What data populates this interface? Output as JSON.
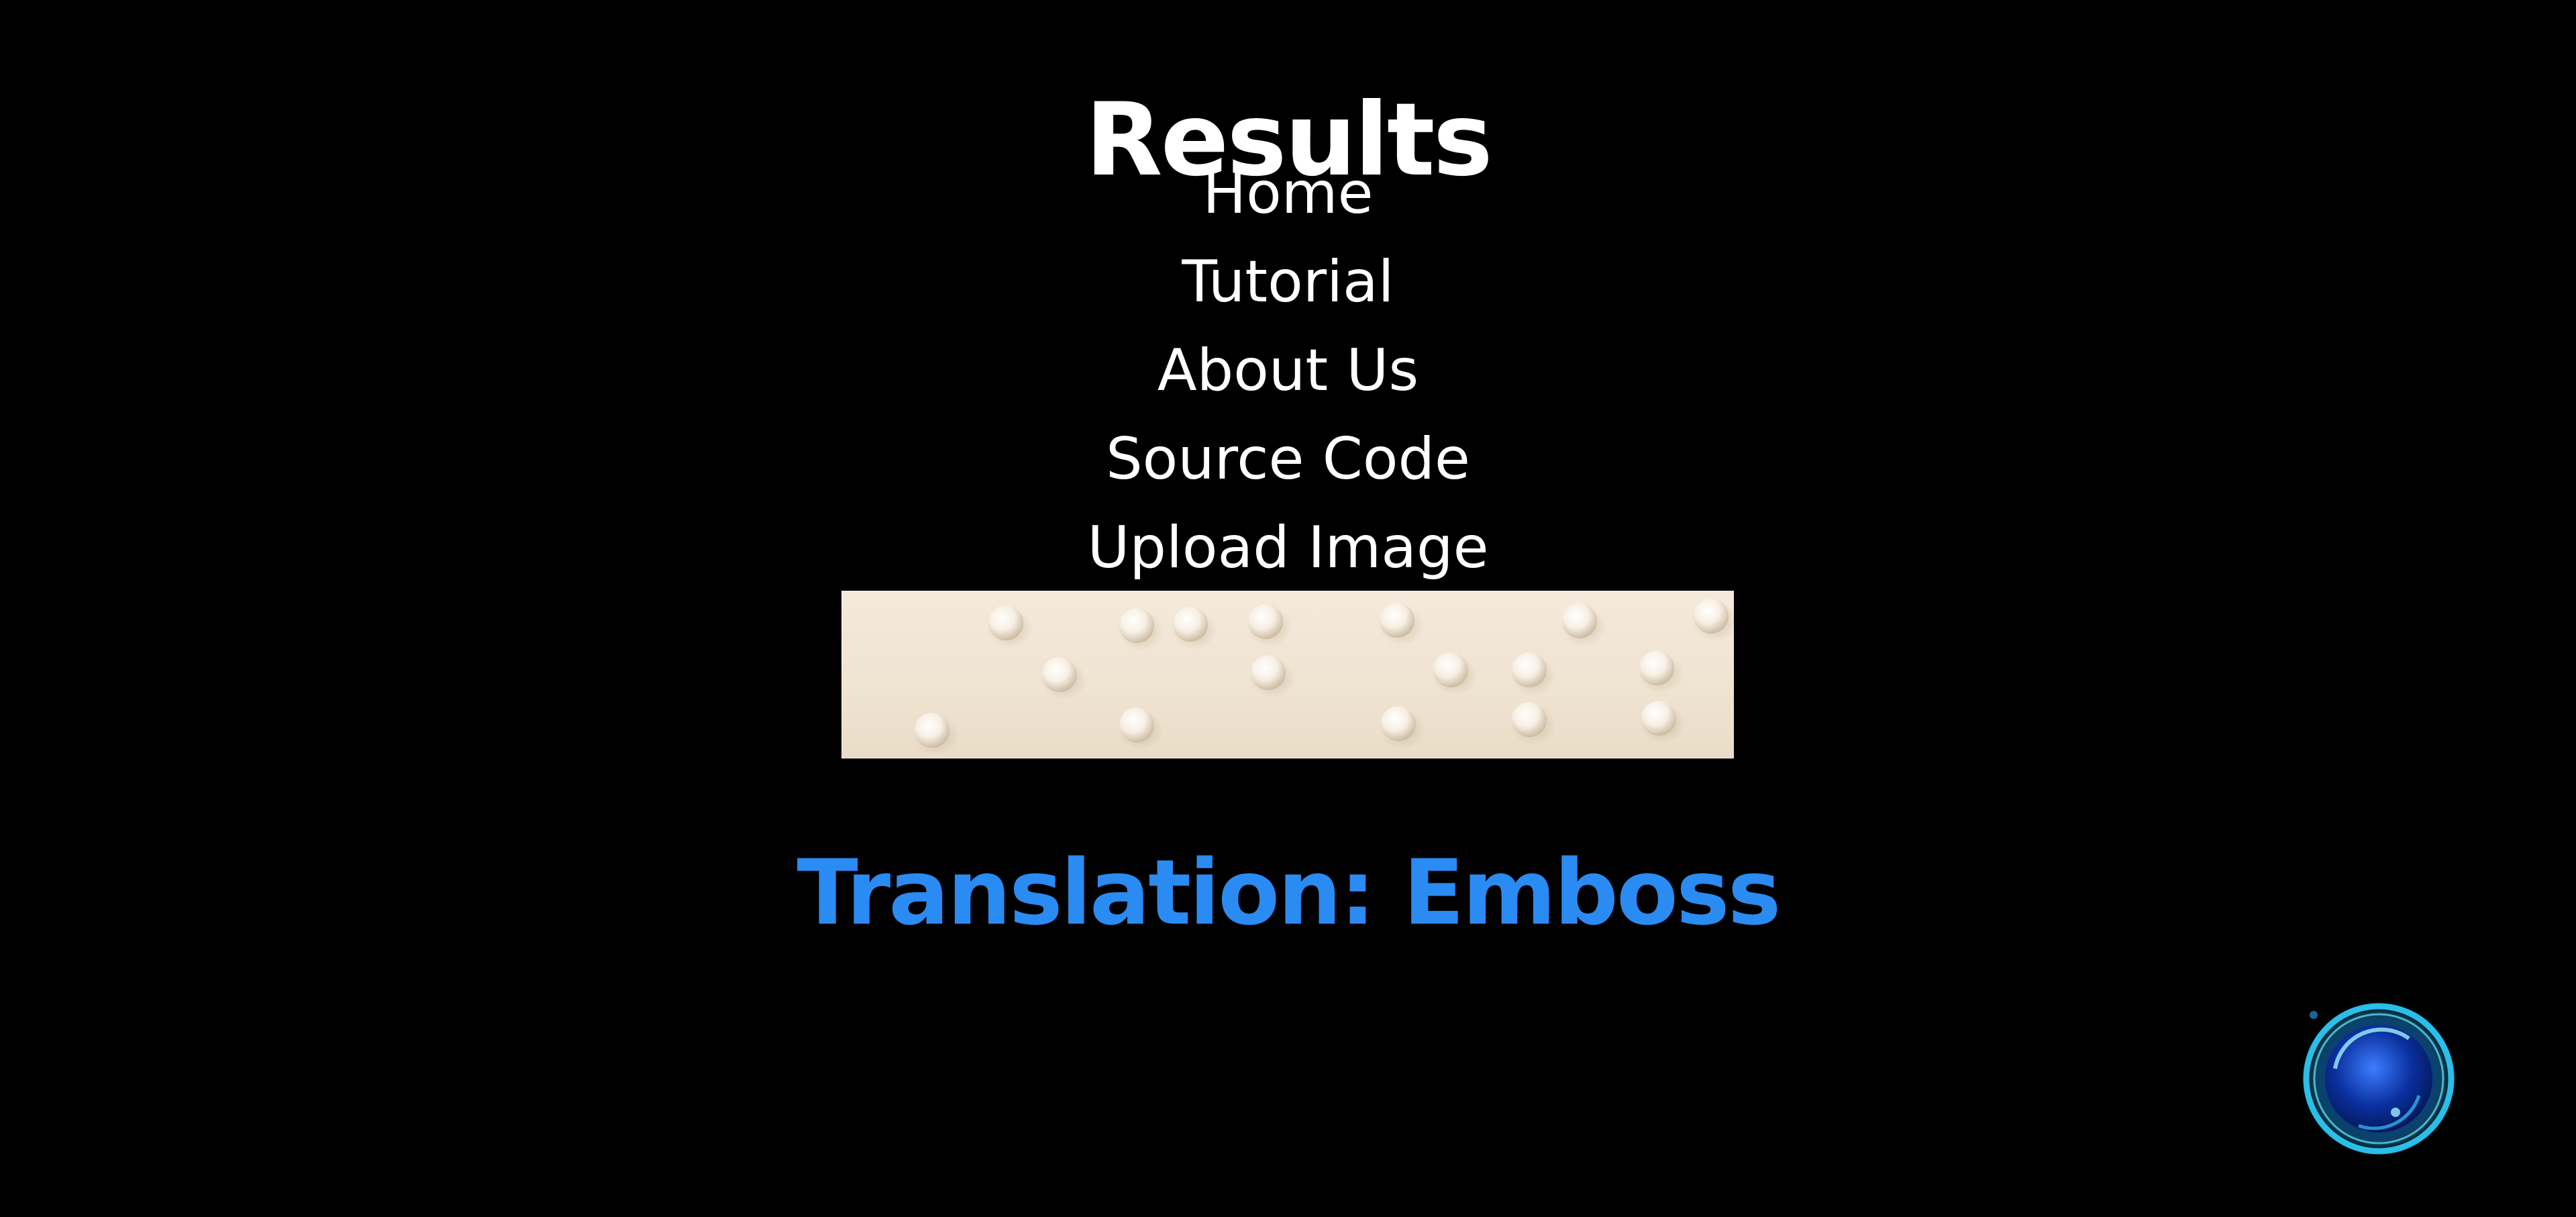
{
  "page": {
    "title": "Results"
  },
  "nav": {
    "items": [
      {
        "label": "Home"
      },
      {
        "label": "Tutorial"
      },
      {
        "label": "About Us"
      },
      {
        "label": "Source Code"
      },
      {
        "label": "Upload Image"
      }
    ]
  },
  "braille_image": {
    "icon": "braille-photo"
  },
  "translation": {
    "text": "Translation: Emboss"
  },
  "orb_button": {
    "icon": "glowing-orb-icon"
  },
  "colors": {
    "background": "#000000",
    "text": "#ffffff",
    "accent": "#2a8bf2",
    "paper": "#f0e4d2"
  }
}
